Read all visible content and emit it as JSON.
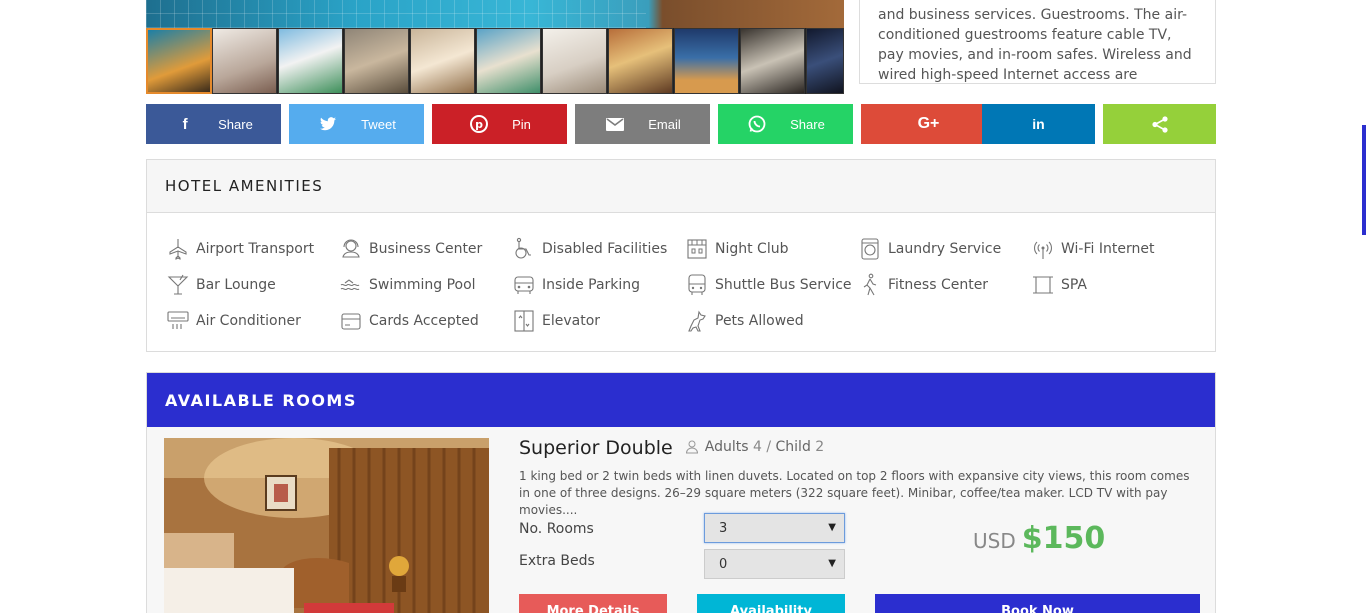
{
  "description": {
    "text": "and business services. Guestrooms. The air-conditioned guestrooms feature cable TV, pay movies, and in-room safes. Wireless and wired high-speed Internet access are available for a"
  },
  "share_buttons": [
    {
      "label": "Share",
      "icon": "facebook-icon",
      "color": "#3b5998"
    },
    {
      "label": "Tweet",
      "icon": "twitter-icon",
      "color": "#55acee"
    },
    {
      "label": "Pin",
      "icon": "pinterest-icon",
      "color": "#cb2027"
    },
    {
      "label": "Email",
      "icon": "email-icon",
      "color": "#7d7d7d"
    },
    {
      "label": "Share",
      "icon": "whatsapp-icon",
      "color": "#25d366"
    },
    {
      "label": "",
      "icon": "google-plus-icon",
      "color": "#dd4b39"
    },
    {
      "label": "",
      "icon": "linkedin-icon",
      "color": "#0077b5"
    },
    {
      "label": "",
      "icon": "share-icon",
      "color": "#95d03a"
    }
  ],
  "amenities": {
    "title": "HOTEL AMENITIES",
    "items": [
      {
        "label": "Airport Transport",
        "icon": "airplane-icon"
      },
      {
        "label": "Business Center",
        "icon": "headset-icon"
      },
      {
        "label": "Disabled Facilities",
        "icon": "wheelchair-icon"
      },
      {
        "label": "Night Club",
        "icon": "building-icon"
      },
      {
        "label": "Laundry Service",
        "icon": "washing-machine-icon"
      },
      {
        "label": "Wi-Fi Internet",
        "icon": "wifi-icon"
      },
      {
        "label": "Bar Lounge",
        "icon": "cocktail-icon"
      },
      {
        "label": "Swimming Pool",
        "icon": "swimming-icon"
      },
      {
        "label": "Inside Parking",
        "icon": "car-icon"
      },
      {
        "label": "Shuttle Bus Service",
        "icon": "bus-icon"
      },
      {
        "label": "Fitness Center",
        "icon": "walking-icon"
      },
      {
        "label": "SPA",
        "icon": "spa-icon"
      },
      {
        "label": "Air Conditioner",
        "icon": "air-conditioner-icon"
      },
      {
        "label": "Cards Accepted",
        "icon": "credit-card-icon"
      },
      {
        "label": "Elevator",
        "icon": "elevator-icon"
      },
      {
        "label": "Pets Allowed",
        "icon": "dog-icon"
      }
    ]
  },
  "rooms": {
    "title": "AVAILABLE ROOMS",
    "room": {
      "name": "Superior Double",
      "adults_label": "Adults",
      "adults": "4",
      "sep": "/",
      "child_label": "Child",
      "child": "2",
      "description": "1 king bed or 2 twin beds with linen duvets. Located on top 2 floors with expansive city views, this room comes in one of three designs. 26–29 square meters (322 square feet). Minibar, coffee/tea maker. LCD TV with pay movies....",
      "rooms_label": "No. Rooms",
      "rooms_value": "3",
      "beds_label": "Extra Beds",
      "beds_value": "0",
      "currency": "USD",
      "price": "$150",
      "buttons": {
        "details": "More Details",
        "availability": "Availability",
        "book": "Book Now"
      }
    }
  },
  "colors": {
    "accent": "#2b2ecf",
    "price": "#5cb85c",
    "details_btn": "#e75b59",
    "availability_btn": "#00b6d6",
    "book_btn": "#2b2ecf"
  }
}
